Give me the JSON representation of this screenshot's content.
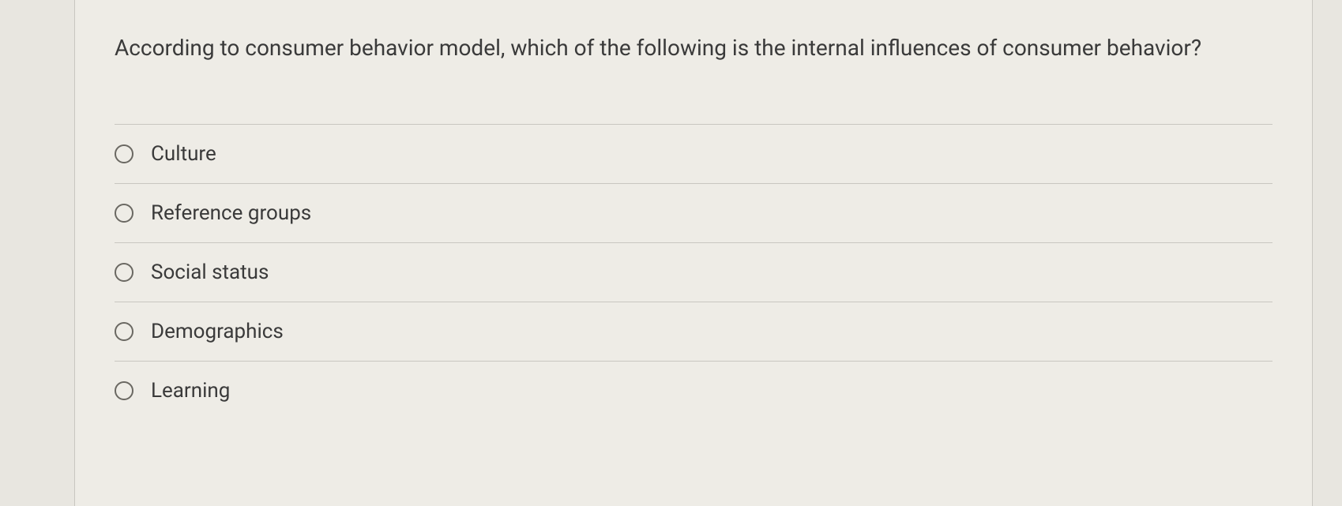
{
  "question": {
    "text": "According to consumer behavior model, which of the following is the internal influences of consumer behavior?"
  },
  "options": [
    {
      "label": "Culture"
    },
    {
      "label": "Reference groups"
    },
    {
      "label": "Social status"
    },
    {
      "label": "Demographics"
    },
    {
      "label": "Learning"
    }
  ]
}
